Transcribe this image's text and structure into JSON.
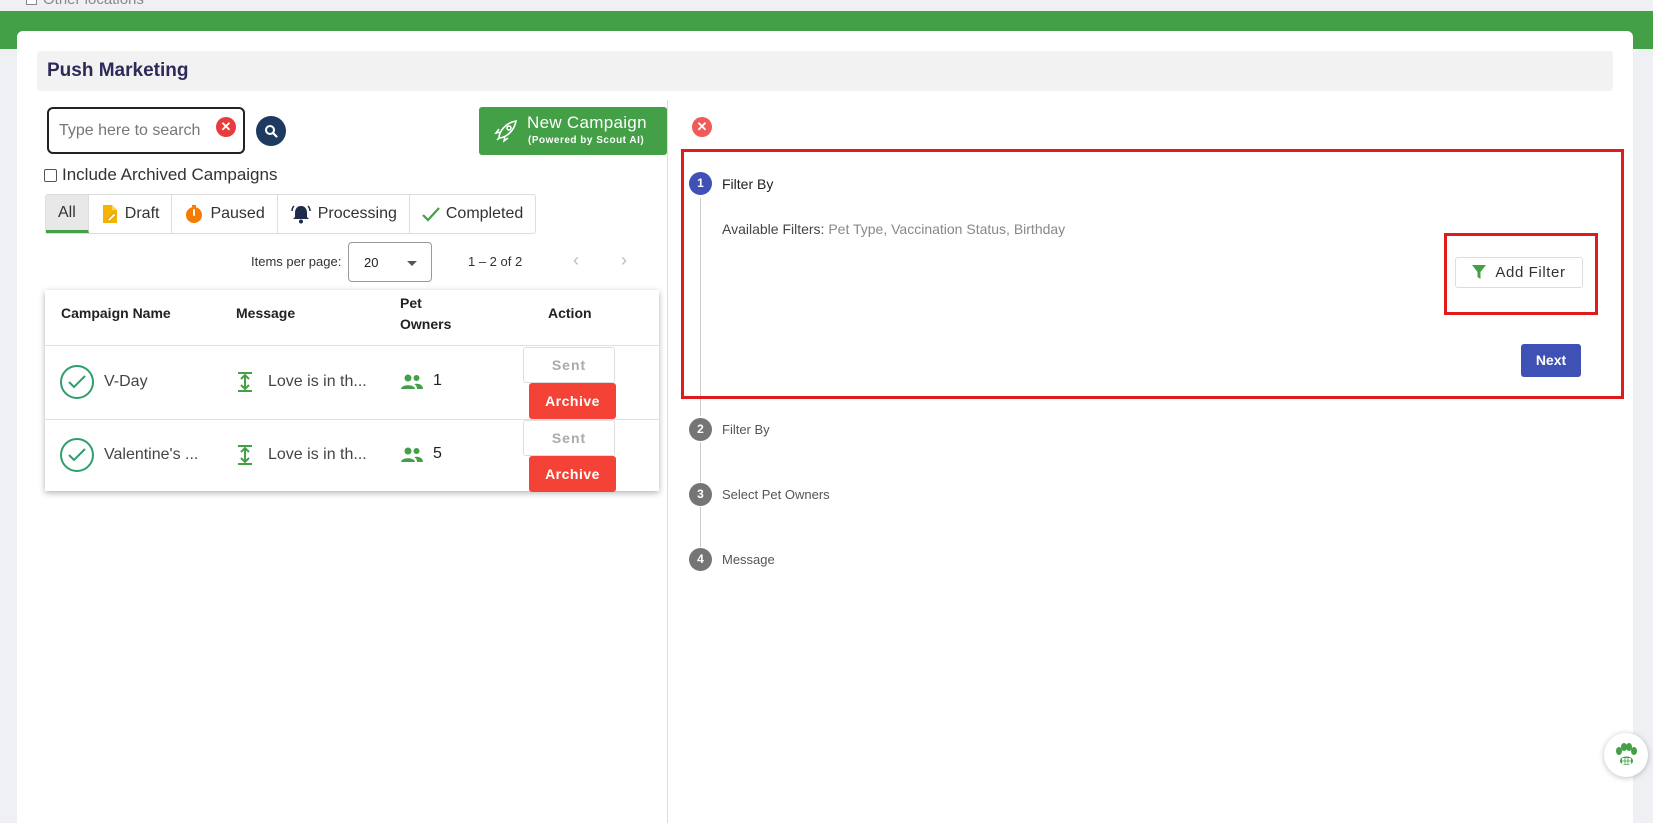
{
  "header": {
    "other_locations": "Other locations",
    "title": "Push Marketing"
  },
  "search": {
    "placeholder": "Type here to search"
  },
  "new_campaign": {
    "label": "New Campaign",
    "sublabel": "(Powered by Scout AI)"
  },
  "include_archived": "Include Archived Campaigns",
  "tabs": [
    {
      "label": "All",
      "icon": "none",
      "active": true
    },
    {
      "label": "Draft",
      "icon": "draft-icon"
    },
    {
      "label": "Paused",
      "icon": "timer-icon"
    },
    {
      "label": "Processing",
      "icon": "bell-icon"
    },
    {
      "label": "Completed",
      "icon": "check-icon"
    }
  ],
  "pagination": {
    "items_per_page_label": "Items per page:",
    "items_per_page": "20",
    "range": "1 – 2 of 2"
  },
  "table": {
    "columns": [
      "Campaign Name",
      "Message",
      "Pet Owners",
      "Action"
    ],
    "rows": [
      {
        "name": "V-Day",
        "message": "Love is in th...",
        "pet_owners": "1",
        "status_label": "Sent",
        "action_label": "Archive"
      },
      {
        "name": "Valentine's ...",
        "message": "Love is in th...",
        "pet_owners": "5",
        "status_label": "Sent",
        "action_label": "Archive"
      }
    ]
  },
  "stepper": {
    "steps": [
      {
        "number": "1",
        "label": "Filter By"
      },
      {
        "number": "2",
        "label": "Filter By"
      },
      {
        "number": "3",
        "label": "Select Pet Owners"
      },
      {
        "number": "4",
        "label": "Message"
      }
    ],
    "available_filters_label": "Available Filters:",
    "available_filters_values": "Pet Type, Vaccination Status, Birthday",
    "add_filter_label": "Add Filter",
    "next_label": "Next"
  },
  "colors": {
    "brand_green": "#43a047",
    "primary_blue": "#3f51b5",
    "archive_red": "#f44336",
    "highlight_red": "#e01b1b"
  }
}
